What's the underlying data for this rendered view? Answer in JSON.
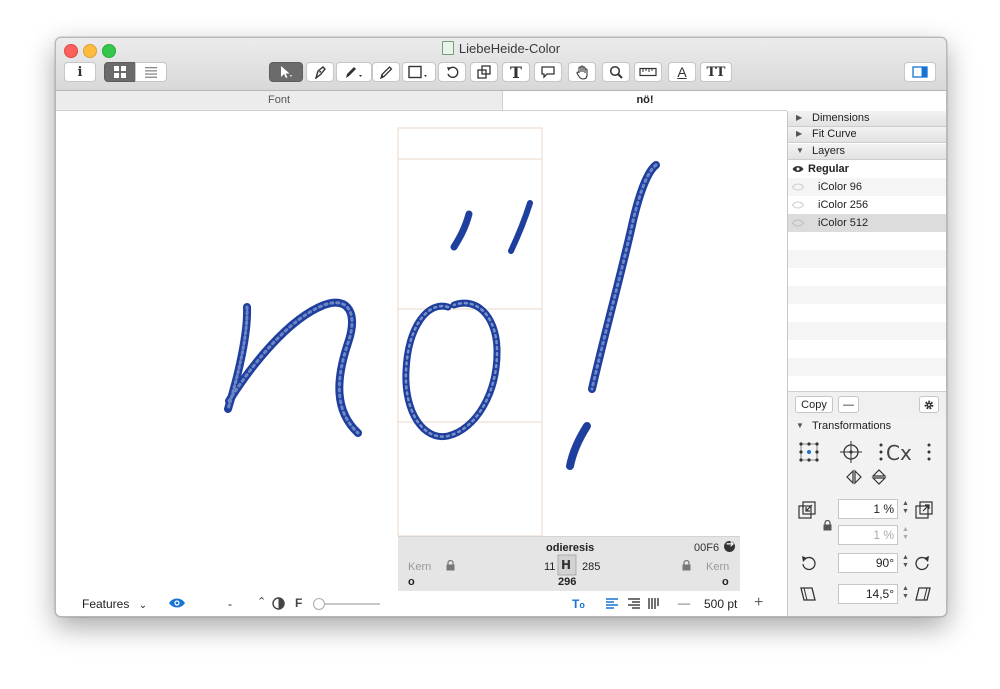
{
  "window": {
    "title": "LiebeHeide-Color"
  },
  "tabs": [
    {
      "label": "Font"
    },
    {
      "label": "nö!"
    }
  ],
  "toolbar": {
    "info_label": "i",
    "text_tool_label": "T",
    "font_info_label": "A",
    "metrics_label": "TT"
  },
  "sidebar": {
    "sections": {
      "dimensions": "Dimensions",
      "fit_curve": "Fit Curve",
      "layers": "Layers",
      "transformations": "Transformations"
    },
    "layers": [
      {
        "name": "Regular",
        "bold": true
      },
      {
        "name": "iColor 96"
      },
      {
        "name": "iColor 256"
      },
      {
        "name": "iColor 512",
        "selected": true
      }
    ],
    "copy_label": "Copy",
    "remove_label": "—",
    "transform": {
      "scale_value": "1 %",
      "scale_value_disabled": "1 %",
      "rotate_value": "90°",
      "slant_value": "14,5°"
    }
  },
  "glyph_info": {
    "name": "odieresis",
    "unicode": "00F6",
    "left_kern_label": "Kern",
    "right_kern_label": "Kern",
    "lsb": "11",
    "rsb": "285",
    "width": "296",
    "left_group": "o",
    "right_group": "o"
  },
  "bottombar": {
    "features_label": "Features",
    "master_label": "-",
    "f_label": "F",
    "zoom_minus": "—",
    "font_size": "500 pt",
    "zoom_plus": "+"
  },
  "colors": {
    "ink": "#1f3f9e",
    "accent": "#1874d2",
    "selected_row": "#dcdcdc"
  }
}
